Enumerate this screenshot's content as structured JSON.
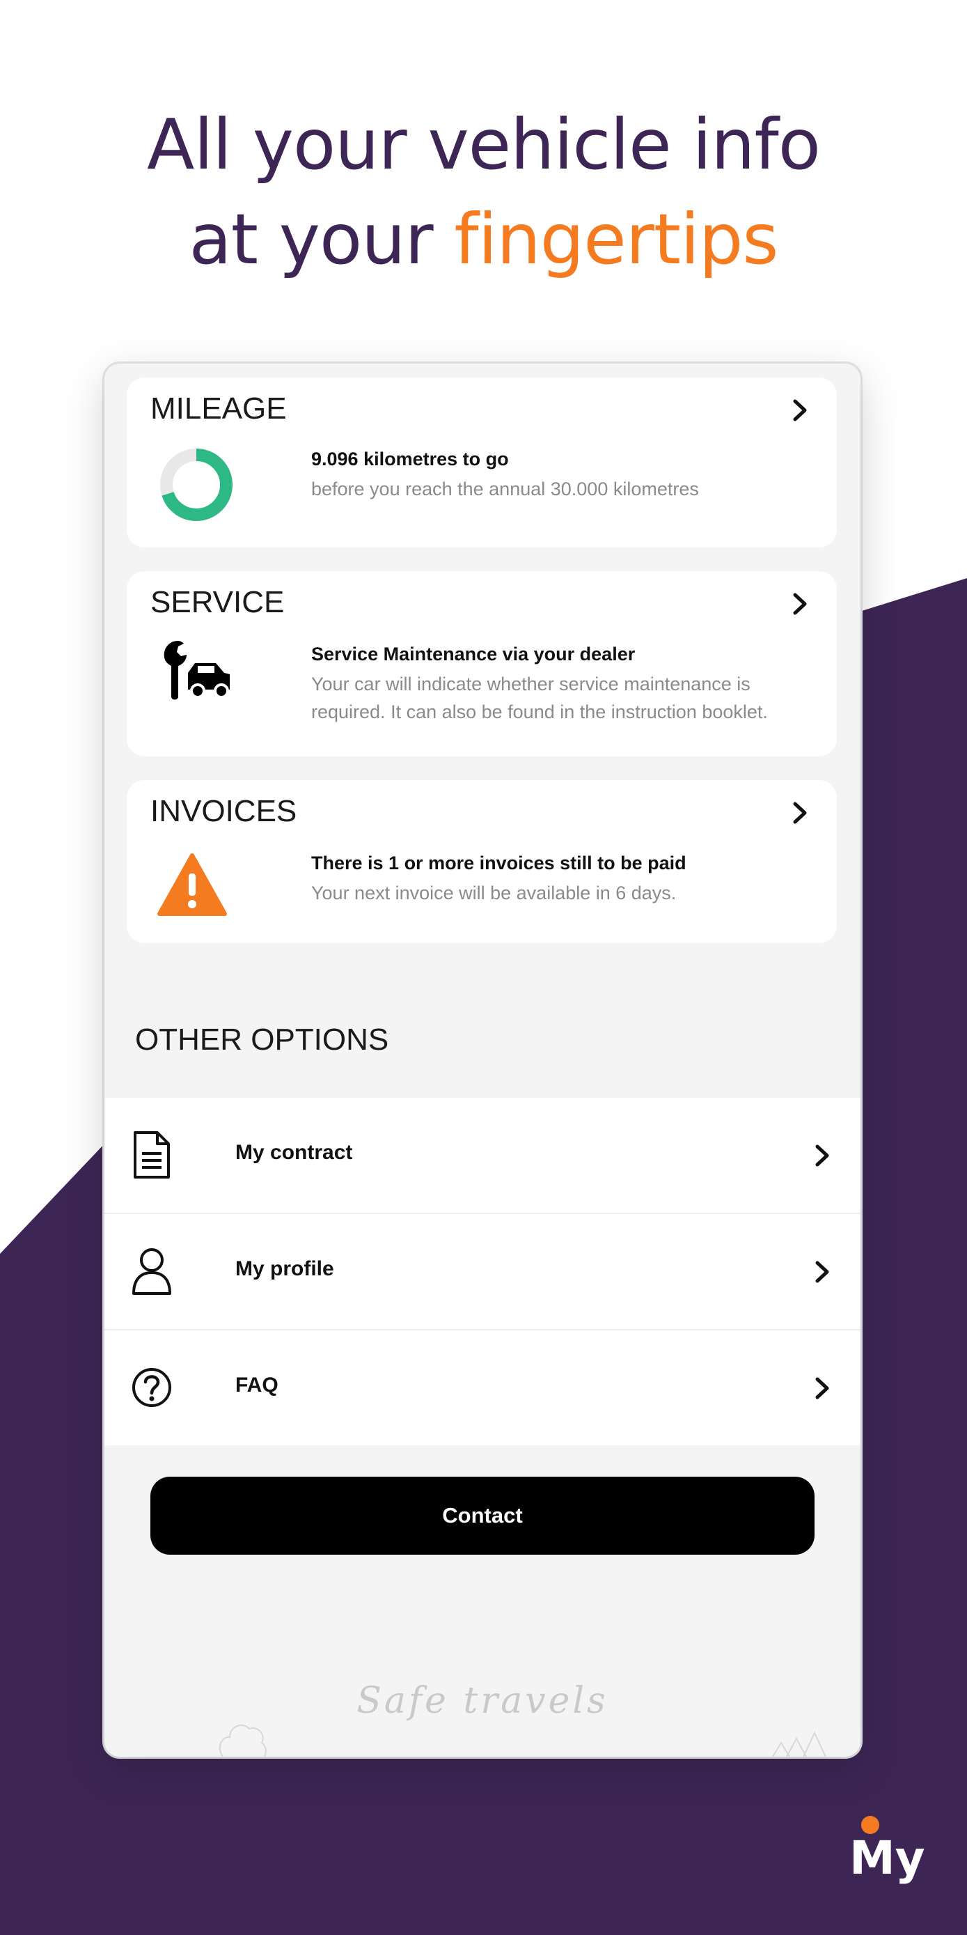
{
  "headline": {
    "line1": "All your vehicle info",
    "line2_prefix": "at your ",
    "line2_accent": "fingertips"
  },
  "colors": {
    "purple": "#3d2656",
    "orange": "#f47b20",
    "green": "#2eb886"
  },
  "cards": {
    "mileage": {
      "title": "MILEAGE",
      "main": "9.096 kilometres to go",
      "sub": "before you reach the annual 30.000 kilometres",
      "progress_fraction": 0.7,
      "icon": "donut-progress-icon"
    },
    "service": {
      "title": "SERVICE",
      "main": "Service Maintenance via your dealer",
      "sub_line1": "Your car will indicate whether service maintenance is",
      "sub_line2": "required. It can also be found in the instruction booklet.",
      "icon": "wrench-car-icon"
    },
    "invoices": {
      "title": "INVOICES",
      "main": "There is 1 or more invoices still to be paid",
      "sub": "Your next invoice will be available in 6 days.",
      "icon": "warning-icon"
    }
  },
  "other_options": {
    "title": "OTHER OPTIONS",
    "items": [
      {
        "label": "My contract",
        "icon": "document-icon"
      },
      {
        "label": "My profile",
        "icon": "user-icon"
      },
      {
        "label": "FAQ",
        "icon": "question-icon"
      }
    ]
  },
  "contact_button": "Contact",
  "footer_text": "Safe travels",
  "logo_text": "My"
}
